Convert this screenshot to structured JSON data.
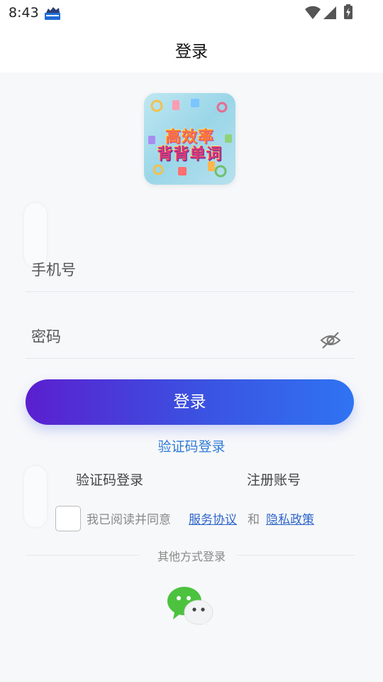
{
  "status_bar": {
    "time": "8:43",
    "icons": [
      "app-notification-icon",
      "wifi-icon",
      "signal-icon",
      "battery-charging-icon"
    ]
  },
  "header": {
    "title": "登录"
  },
  "logo": {
    "line1": "高效率",
    "line2": "背背单词"
  },
  "form": {
    "phone_placeholder": "手机号",
    "password_placeholder": "密码",
    "password_toggle_icon": "eye-off-icon",
    "login_button": "登录",
    "sms_login_link": "验证码登录"
  },
  "options": {
    "sms_login": "验证码登录",
    "register": "注册账号"
  },
  "agreement": {
    "checked": false,
    "prefix": "我已阅读并同意",
    "service": "服务协议",
    "and": "和",
    "privacy": "隐私政策"
  },
  "other_login": {
    "title": "其他方式登录",
    "icon": "wechat-icon"
  },
  "colors": {
    "button_start": "#5b1fd0",
    "button_end": "#2f74f2",
    "link": "#2f7bd6",
    "background": "#f7f8fa",
    "wechat_green": "#4cc23f"
  }
}
